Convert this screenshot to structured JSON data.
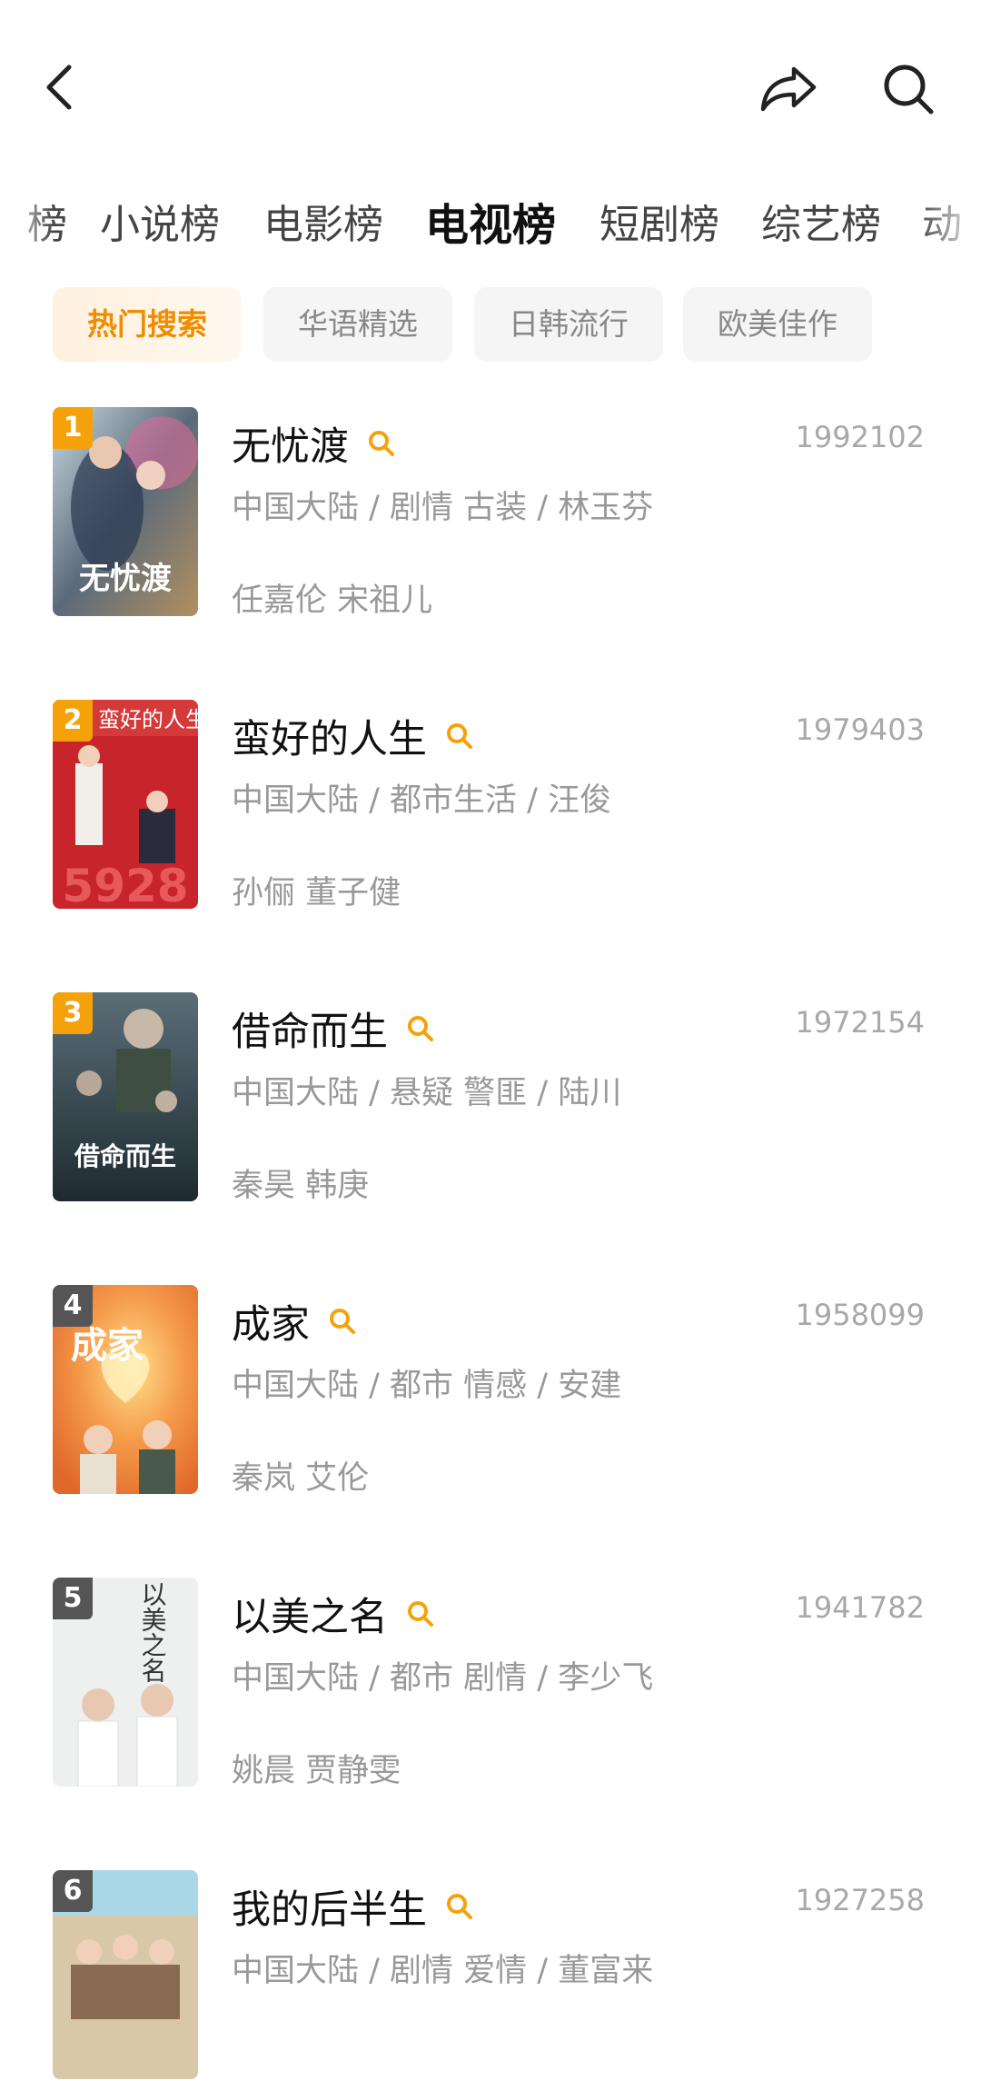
{
  "header": {
    "back_icon": "chevron-left-icon",
    "share_icon": "share-arrow-icon",
    "search_icon": "search-icon"
  },
  "category_tabs": [
    {
      "label": "榜"
    },
    {
      "label": "小说榜"
    },
    {
      "label": "电影榜"
    },
    {
      "label": "电视榜"
    },
    {
      "label": "短剧榜"
    },
    {
      "label": "综艺榜"
    },
    {
      "label": "动"
    }
  ],
  "active_category": "电视榜",
  "filter_chips": [
    {
      "label": "热门搜索"
    },
    {
      "label": "华语精选"
    },
    {
      "label": "日韩流行"
    },
    {
      "label": "欧美佳作"
    }
  ],
  "active_chip": "热门搜索",
  "colors": {
    "accent": "#f5a20a",
    "rank_top3": "#f5a20a",
    "rank_other": "#555555",
    "chip_active_text": "#f08c00"
  },
  "items": [
    {
      "rank": "1",
      "title": "无忧渡",
      "score": "1992102",
      "meta": "中国大陆 / 剧情 古装 / 林玉芬",
      "cast": "任嘉伦 宋祖儿",
      "poster_text": "无忧渡"
    },
    {
      "rank": "2",
      "title": "蛮好的人生",
      "score": "1979403",
      "meta": "中国大陆 / 都市生活 / 汪俊",
      "cast": "孙俪 董子健",
      "poster_text": "蛮好的人生"
    },
    {
      "rank": "3",
      "title": "借命而生",
      "score": "1972154",
      "meta": "中国大陆 / 悬疑 警匪 / 陆川",
      "cast": "秦昊 韩庚",
      "poster_text": "借命而生"
    },
    {
      "rank": "4",
      "title": "成家",
      "score": "1958099",
      "meta": "中国大陆 / 都市 情感 / 安建",
      "cast": "秦岚 艾伦",
      "poster_text": "成家"
    },
    {
      "rank": "5",
      "title": "以美之名",
      "score": "1941782",
      "meta": "中国大陆 / 都市 剧情 / 李少飞",
      "cast": "姚晨 贾静雯",
      "poster_text": "以美之名"
    },
    {
      "rank": "6",
      "title": "我的后半生",
      "score": "1927258",
      "meta": "中国大陆 / 剧情 爱情 / 董富来",
      "cast": "",
      "poster_text": ""
    }
  ]
}
